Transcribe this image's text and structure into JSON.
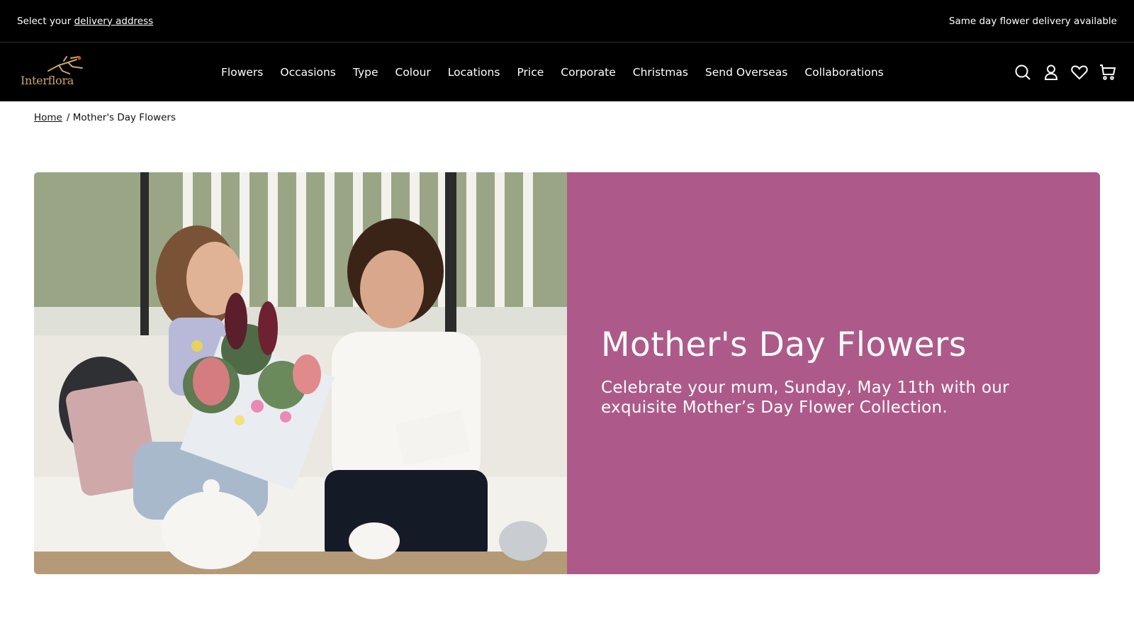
{
  "topbar": {
    "select_prefix": "Select your",
    "delivery_link": "delivery address",
    "promo": "Same day flower delivery available"
  },
  "header": {
    "logo_text": "Interflora",
    "nav": [
      {
        "label": "Flowers"
      },
      {
        "label": "Occasions"
      },
      {
        "label": "Type"
      },
      {
        "label": "Colour"
      },
      {
        "label": "Locations"
      },
      {
        "label": "Price"
      },
      {
        "label": "Corporate"
      },
      {
        "label": "Christmas"
      },
      {
        "label": "Send Overseas"
      },
      {
        "label": "Collaborations"
      }
    ],
    "icons": [
      "search-icon",
      "account-icon",
      "heart-icon",
      "cart-icon"
    ]
  },
  "breadcrumb": {
    "home": "Home",
    "current": "/ Mother's Day Flowers"
  },
  "hero": {
    "title": "Mother's Day Flowers",
    "subtitle": "Celebrate your mum, Sunday, May 11th with our exquisite Mother’s Day Flower Collection.",
    "panel_color": "#ad5a8a"
  },
  "colors": {
    "header_bg": "#000000",
    "logo_gold": "#c9a66b"
  }
}
